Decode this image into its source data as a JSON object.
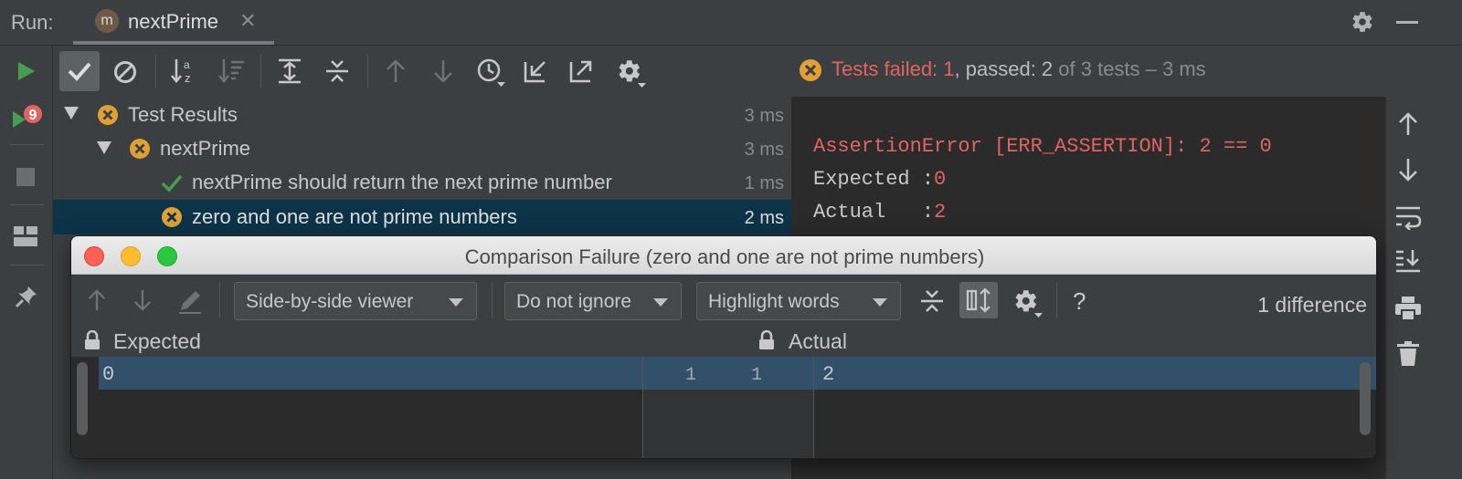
{
  "run_bar": {
    "label": "Run:",
    "tab": {
      "icon_letter": "m",
      "title": "nextPrime"
    }
  },
  "status": {
    "failed_label": "Tests failed: 1",
    "passed_sep": ",",
    "passed_label": " passed: 2",
    "total_label": " of 3 tests – 3 ms"
  },
  "tree": {
    "rows": [
      {
        "label": "Test Results",
        "time": "3 ms",
        "status": "failed"
      },
      {
        "label": "nextPrime",
        "time": "3 ms",
        "status": "failed"
      },
      {
        "label": "nextPrime should return the next prime number",
        "time": "1 ms",
        "status": "passed"
      },
      {
        "label": "zero and one are not prime numbers",
        "time": "2 ms",
        "status": "failed",
        "selected": true
      }
    ]
  },
  "console": {
    "error_line": "AssertionError [ERR_ASSERTION]: 2 == 0",
    "expected_prefix": "Expected :",
    "expected_value": "0",
    "actual_prefix": "Actual   :",
    "actual_value": "2"
  },
  "dialog": {
    "title": "Comparison Failure (zero and one are not prime numbers)",
    "viewer_select": "Side-by-side viewer",
    "ignore_select": "Do not ignore",
    "highlight_select": "Highlight words",
    "help": "?",
    "difference_count": "1 difference",
    "left_header": "Expected",
    "right_header": "Actual",
    "left_line_number": "1",
    "right_line_number": "1",
    "left_value": "0",
    "right_value": "2"
  },
  "colors": {
    "fail": "#e26461",
    "pass": "#499c54",
    "warn_icon": "#e0a036",
    "selection": "#0d3349",
    "diff_highlight": "#33506b"
  },
  "icons": [
    "run-icon",
    "rerun-failed-icon",
    "stop-icon",
    "layout-icon",
    "pin-icon",
    "show-passed-icon",
    "show-ignored-icon",
    "sort-alpha-icon",
    "sort-duration-icon",
    "expand-all-icon",
    "collapse-all-icon",
    "prev-failed-icon",
    "next-failed-icon",
    "history-icon",
    "import-icon",
    "export-icon",
    "settings-icon",
    "up-arrow-icon",
    "down-arrow-icon",
    "soft-wrap-icon",
    "scroll-to-end-icon",
    "print-icon",
    "trash-icon",
    "lock-icon"
  ]
}
